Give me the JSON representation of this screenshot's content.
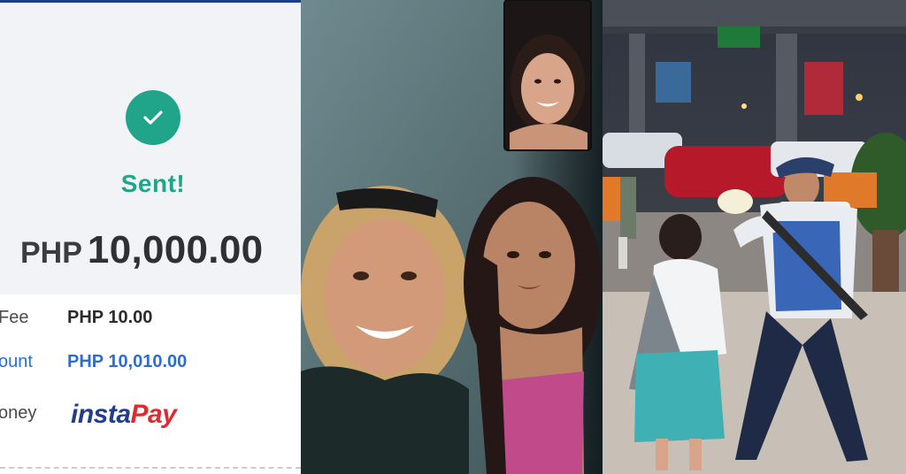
{
  "receipt": {
    "status": "Sent!",
    "amount": {
      "currency": "PHP",
      "value": "10,000.00"
    },
    "fee": {
      "label": "Fee",
      "value": "PHP 10.00"
    },
    "total": {
      "label": "ount",
      "value": "PHP 10,010.00"
    },
    "source": {
      "label": "oney",
      "brand_insta": "insta",
      "brand_pay": "Pay"
    },
    "icon": "check-icon",
    "colors": {
      "accent": "#20a58a",
      "link": "#2a6fd0",
      "brand_blue": "#233d8e",
      "brand_red": "#e02a2f"
    }
  },
  "photos": {
    "middle": "selfie-video-call-photo",
    "right": "traffic-officer-street-photo"
  }
}
